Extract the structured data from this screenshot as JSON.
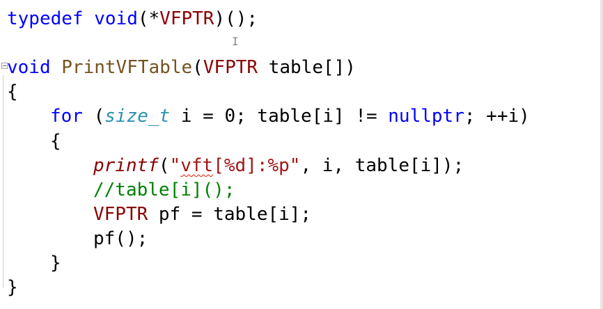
{
  "code": {
    "l1": {
      "kw": "typedef",
      "kw2": "void",
      "rest": "(*",
      "macro": "VFPTR",
      "end": ")();"
    },
    "l3": {
      "kw": "void",
      "fn": "PrintVFTable",
      "open": "(",
      "macro": "VFPTR",
      "rest": " table[])"
    },
    "l4": "{",
    "l5": {
      "kw": "for",
      "p1": " (",
      "type": "size_t",
      "p2": " i = 0; table[i] != ",
      "kw2": "nullptr",
      "p3": "; ++i)"
    },
    "l6": "{",
    "l7": {
      "fn": "printf",
      "p1": "(",
      "str_q": "\"",
      "str_squig": "vft",
      "str_rest": "[%d]:%p\"",
      "p2": ", i, table[i]);"
    },
    "l8": "//table[i]();",
    "l9": {
      "macro": "VFPTR",
      "rest": " pf = table[i];"
    },
    "l10": "pf();",
    "l11": "}",
    "l12": "}"
  },
  "colors": {
    "keyword": "#0000ff",
    "function": "#74531f",
    "macro": "#8b0000",
    "type": "#2b91af",
    "string": "#a31515",
    "comment": "#008000"
  },
  "icons": {
    "cursor": "ibeam-cursor-icon",
    "collapse": "collapse-toggle-icon"
  }
}
